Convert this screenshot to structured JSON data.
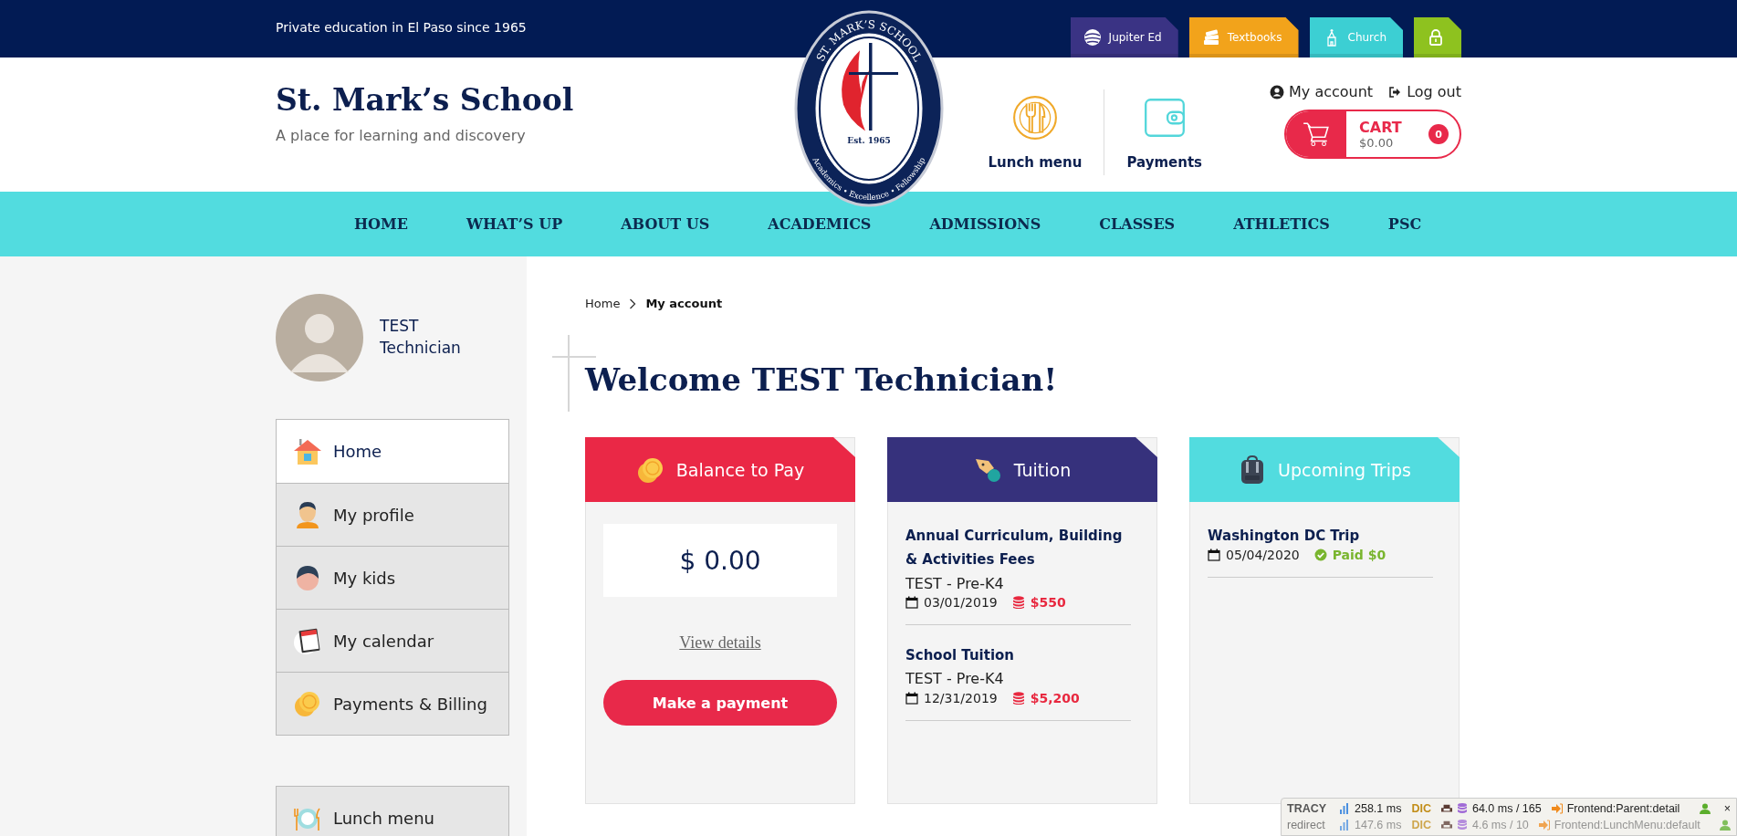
{
  "top_bar": {
    "tagline": "Private education in El Paso since 1965",
    "quick_links": [
      {
        "label": "Jupiter Ed",
        "color": "#3a3384",
        "kind": "globe"
      },
      {
        "label": "Textbooks",
        "color": "#f2a31b",
        "kind": "books"
      },
      {
        "label": "Church",
        "color": "#3ccfd3",
        "kind": "church"
      },
      {
        "color": "#8ec21f",
        "kind": "lock"
      }
    ]
  },
  "header": {
    "title": "St. Mark’s School",
    "subtitle": "A place for learning and discovery",
    "logo": {
      "ring_top": "ST. MARK’S SCHOOL",
      "ring_bottom": "Academics • Excellence • Fellowship",
      "est": "Est. 1965"
    },
    "shortcuts": [
      {
        "label": "Lunch menu",
        "kind": "lunch"
      },
      {
        "label": "Payments",
        "kind": "wallet"
      }
    ],
    "account_links": [
      {
        "label": "My account",
        "kind": "account"
      },
      {
        "label": "Log out",
        "kind": "logout"
      }
    ],
    "cart": {
      "label": "CART",
      "total": "$0.00",
      "count": "0"
    }
  },
  "nav": [
    "HOME",
    "WHAT’S UP",
    "ABOUT US",
    "ACADEMICS",
    "ADMISSIONS",
    "CLASSES",
    "ATHLETICS",
    "PSC"
  ],
  "sidebar": {
    "user_name": "TEST Technician",
    "menu": [
      {
        "label": "Home",
        "kind": "home",
        "selected": true
      },
      {
        "label": "My profile",
        "kind": "profile",
        "selected": false
      },
      {
        "label": "My kids",
        "kind": "kids",
        "selected": false
      },
      {
        "label": "My calendar",
        "kind": "calendar",
        "selected": false
      },
      {
        "label": "Payments & Billing",
        "kind": "coins",
        "selected": false
      }
    ],
    "secondary_menu": [
      {
        "label": "Lunch menu",
        "kind": "plate",
        "selected": false
      }
    ]
  },
  "breadcrumb": [
    "Home",
    "My account"
  ],
  "heading": "Welcome TEST Technician!",
  "cards": [
    {
      "kind": "balance",
      "title": "Balance to Pay",
      "color": "#ea2846",
      "amount": "$ 0.00",
      "link": "View details",
      "button": "Make a payment"
    },
    {
      "kind": "list",
      "title": "Tuition",
      "color": "#36317c",
      "items": [
        {
          "title": "Annual Curriculum, Building & Activities Fees",
          "subtitle": "TEST - Pre-K4",
          "date": "03/01/2019",
          "amount": "$550",
          "kind": "due"
        },
        {
          "title": "School Tuition",
          "subtitle": "TEST - Pre-K4",
          "date": "12/31/2019",
          "amount": "$5,200",
          "kind": "due"
        }
      ]
    },
    {
      "kind": "list",
      "title": "Upcoming Trips",
      "color": "#52dcdf",
      "items": [
        {
          "title": "Washington DC Trip",
          "date": "05/04/2020",
          "amount": "Paid $0",
          "kind": "paid"
        }
      ]
    }
  ],
  "debug_bar": {
    "rows": [
      {
        "label": "TRACY",
        "time": "258.1 ms",
        "dic": "DIC",
        "db": "64.0 ms / 165",
        "route": "Frontend:Parent:detail",
        "dimmed": false
      },
      {
        "label": "redirect",
        "time": "147.6 ms",
        "dic": "DIC",
        "db": "4.6 ms / 10",
        "route": "Frontend:LunchMenu:default",
        "dimmed": true
      }
    ],
    "close": "×"
  }
}
